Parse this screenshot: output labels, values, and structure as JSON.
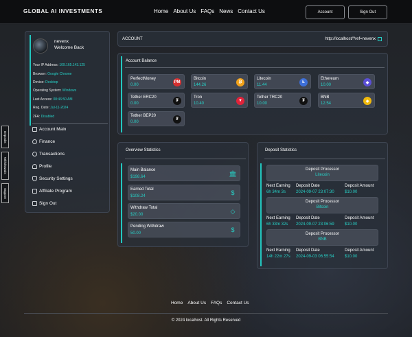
{
  "header": {
    "brand": "GLOBAL AI INVESTMENTS",
    "nav": [
      "Home",
      "About Us",
      "FAQs",
      "News",
      "Contact Us"
    ],
    "account_button": "Account",
    "signout_button": "Sign Out"
  },
  "side_tabs": [
    "Deposits",
    "Withdrawals",
    "Support"
  ],
  "user": {
    "name": "nevenx",
    "welcome": "Welcome Back",
    "info": [
      {
        "label": "Your IP Address:",
        "value": "109.165.143.125"
      },
      {
        "label": "Browser:",
        "value": "Google Chrome"
      },
      {
        "label": "Device:",
        "value": "Desktop"
      },
      {
        "label": "Operating System:",
        "value": "Windows"
      },
      {
        "label": "Last Access:",
        "value": "08:46:50 AM"
      },
      {
        "label": "Reg. Date:",
        "value": "Jul-11-2024"
      },
      {
        "label": "2FA:",
        "value": "Disabled"
      }
    ]
  },
  "menu": [
    {
      "label": "Account Main",
      "icon": "home-icon"
    },
    {
      "label": "Finance",
      "icon": "finance-icon"
    },
    {
      "label": "Transactions",
      "icon": "transactions-icon"
    },
    {
      "label": "Profile",
      "icon": "user-icon"
    },
    {
      "label": "Security Settings",
      "icon": "shield-icon"
    },
    {
      "label": "Affiliate Program",
      "icon": "network-icon"
    },
    {
      "label": "Sign Out",
      "icon": "signout-icon"
    }
  ],
  "account": {
    "title": "ACCOUNT",
    "ref_link": "http://localhost/?ref=nevenx"
  },
  "balance": {
    "title": "Account Balance",
    "coins": [
      {
        "name": "PerfectMoney",
        "value": "0.00",
        "glyph": "PM",
        "color": "#d62f2f"
      },
      {
        "name": "Bitcoin",
        "value": "144.26",
        "glyph": "₿",
        "color": "#f2a31b"
      },
      {
        "name": "Litecoin",
        "value": "11.44",
        "glyph": "Ł",
        "color": "#3d6fd8"
      },
      {
        "name": "Ethereum",
        "value": "10.00",
        "glyph": "◆",
        "color": "#5b4fd6"
      },
      {
        "name": "Tether ERC20",
        "value": "0.00",
        "glyph": "₮",
        "color": "#111111"
      },
      {
        "name": "Tron",
        "value": "10.40",
        "glyph": "▼",
        "color": "#e0233a"
      },
      {
        "name": "Tether TRC20",
        "value": "10.00",
        "glyph": "₮",
        "color": "#111111"
      },
      {
        "name": "BNB",
        "value": "12.54",
        "glyph": "◈",
        "color": "#f0b90b"
      },
      {
        "name": "Tether BEP20",
        "value": "0.00",
        "glyph": "₮",
        "color": "#111111"
      }
    ]
  },
  "overview": {
    "title": "Overview Statistics",
    "stats": [
      {
        "label": "Main Balance",
        "value": "$198.64",
        "icon": "bank-icon",
        "glyph": "🏛"
      },
      {
        "label": "Earned Total",
        "value": "$108.24",
        "icon": "dollar-circle-icon",
        "glyph": "$"
      },
      {
        "label": "Withdraw Total",
        "value": "$20.00",
        "icon": "wallet-icon",
        "glyph": "◇"
      },
      {
        "label": "Pending Withdraw",
        "value": "50.00",
        "icon": "dollar-icon",
        "glyph": "$"
      }
    ]
  },
  "deposit": {
    "title": "Deposit Statistics",
    "processor_label": "Deposit Processor",
    "next_label": "Next Earning",
    "date_label": "Deposit Date",
    "amount_label": "Deposit Amount",
    "items": [
      {
        "processor": "Litecoin",
        "next": "6h 34m 3s",
        "date": "2024-09-07 23:07:30",
        "amount": "$10.00"
      },
      {
        "processor": "Bitcoin",
        "next": "6h 33m 32s",
        "date": "2024-09-07 23:06:59",
        "amount": "$10.00"
      },
      {
        "processor": "BNB",
        "next": "14h 22m 27s",
        "date": "2024-09-03 06:55:54",
        "amount": "$10.00"
      }
    ]
  },
  "footer": {
    "nav": [
      "Home",
      "About Us",
      "FAQs",
      "Contact Us"
    ],
    "copyright": "© 2024 localhost. All Rights Reserved"
  },
  "colors": {
    "accent": "#27d0c6"
  }
}
